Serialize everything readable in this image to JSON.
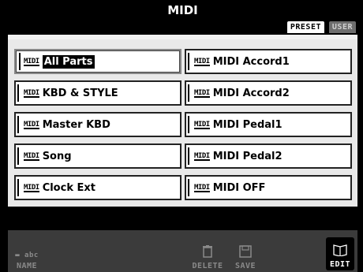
{
  "title": "MIDI",
  "tabs": {
    "preset": "PRESET",
    "user": "USER"
  },
  "icon_text": "MIDI",
  "left_items": [
    "All Parts",
    "KBD & STYLE",
    "Master KBD",
    "Song",
    "Clock Ext"
  ],
  "right_items": [
    "MIDI Accord1",
    "MIDI Accord2",
    "MIDI Pedal1",
    "MIDI Pedal2",
    "MIDI OFF"
  ],
  "footer": {
    "name_icon": "▬ abc",
    "name": "NAME",
    "delete": "DELETE",
    "save": "SAVE",
    "edit": "EDIT"
  },
  "selected_item": "All Parts"
}
